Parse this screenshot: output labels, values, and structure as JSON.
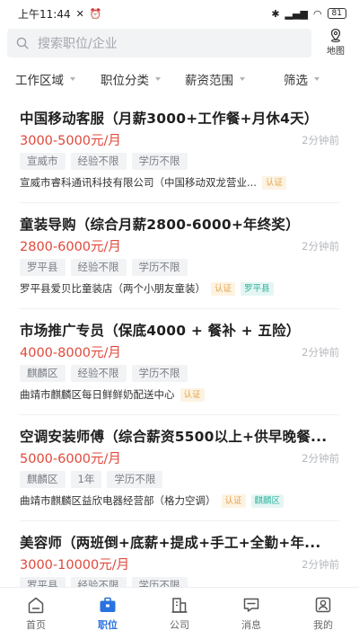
{
  "status_bar": {
    "time": "上午11:44",
    "battery": "81"
  },
  "search": {
    "placeholder": "搜索职位/企业",
    "map_label": "地图"
  },
  "filters": [
    {
      "label": "工作区域"
    },
    {
      "label": "职位分类"
    },
    {
      "label": "薪资范围"
    },
    {
      "label": "筛选"
    }
  ],
  "jobs": [
    {
      "title": "中国移动客服（月薪3000+工作餐+月休4天）",
      "salary": "3000-5000元/月",
      "time": "2分钟前",
      "tags": [
        "宣威市",
        "经验不限",
        "学历不限"
      ],
      "company": "宣威市睿科通讯科技有限公司（中国移动双龙营业...",
      "badges": [
        {
          "text": "认证",
          "kind": "verified"
        }
      ]
    },
    {
      "title": "童装导购（综合月薪2800-6000+年终奖）",
      "salary": "2800-6000元/月",
      "time": "2分钟前",
      "tags": [
        "罗平县",
        "经验不限",
        "学历不限"
      ],
      "company": "罗平县爱贝比童装店（两个小朋友童装）",
      "badges": [
        {
          "text": "认证",
          "kind": "verified"
        },
        {
          "text": "罗平县",
          "kind": "area"
        }
      ]
    },
    {
      "title": "市场推广专员（保底4000 + 餐补 + 五险）",
      "salary": "4000-8000元/月",
      "time": "2分钟前",
      "tags": [
        "麒麟区",
        "经验不限",
        "学历不限"
      ],
      "company": "曲靖市麒麟区每日鲜鲜奶配送中心",
      "badges": [
        {
          "text": "认证",
          "kind": "verified"
        }
      ]
    },
    {
      "title": "空调安装师傅（综合薪资5500以上+供早晚餐...",
      "salary": "5000-6000元/月",
      "time": "2分钟前",
      "tags": [
        "麒麟区",
        "1年",
        "学历不限"
      ],
      "company": "曲靖市麒麟区益欣电器经营部（格力空调）",
      "badges": [
        {
          "text": "认证",
          "kind": "verified"
        },
        {
          "text": "麒麟区",
          "kind": "area"
        }
      ]
    },
    {
      "title": "美容师（两班倒+底薪+提成+手工+全勤+年...",
      "salary": "3000-10000元/月",
      "time": "2分钟前",
      "tags": [
        "罗平县",
        "经验不限",
        "学历不限"
      ],
      "company": "",
      "badges": []
    }
  ],
  "tabs": [
    {
      "label": "首页",
      "icon": "home-icon",
      "active": false
    },
    {
      "label": "职位",
      "icon": "briefcase-icon",
      "active": true
    },
    {
      "label": "公司",
      "icon": "building-icon",
      "active": false
    },
    {
      "label": "消息",
      "icon": "message-icon",
      "active": false
    },
    {
      "label": "我的",
      "icon": "profile-icon",
      "active": false
    }
  ],
  "colors": {
    "accent": "#2a72e0",
    "salary": "#e0483b",
    "verified_badge": "#e3a34a",
    "area_badge": "#2fb3a0"
  }
}
